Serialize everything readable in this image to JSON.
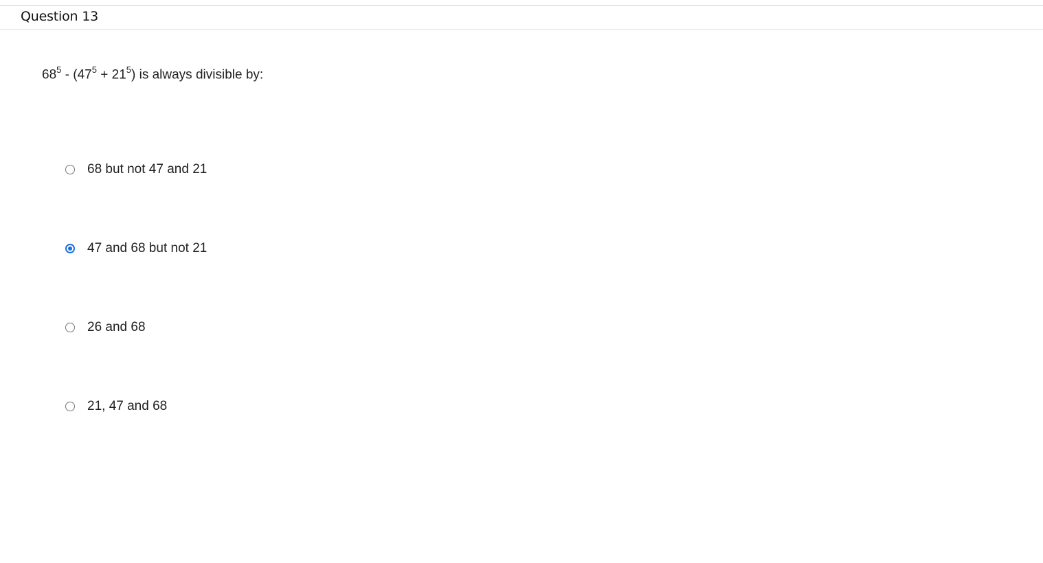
{
  "question": {
    "title": "Question 13",
    "text_parts": {
      "base1": "68",
      "exp1": "5",
      "mid1": " - (47",
      "exp2": "5",
      "mid2": " + 21",
      "exp3": "5",
      "tail": ") is always divisible by:"
    }
  },
  "options": [
    {
      "label": "68 but not 47 and 21",
      "selected": false
    },
    {
      "label": "47 and 68 but not 21",
      "selected": true
    },
    {
      "label": "26 and 68",
      "selected": false
    },
    {
      "label": "21, 47 and 68",
      "selected": false
    }
  ],
  "colors": {
    "radio_selected": "#1a6fe0",
    "radio_border": "#767676",
    "divider": "#dcdcdc"
  }
}
